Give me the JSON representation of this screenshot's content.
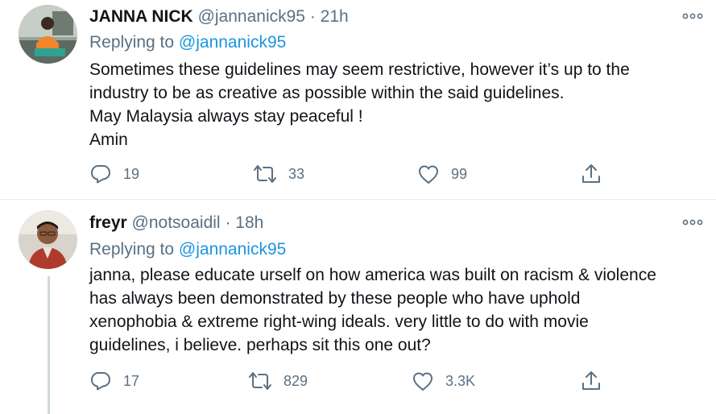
{
  "tweets": [
    {
      "display_name": "JANNA NICK",
      "handle": "@jannanick95",
      "separator": "·",
      "time": "21h",
      "replying_prefix": "Replying to",
      "replying_to": "@jannanick95",
      "body_lines": [
        "Sometimes these guidelines may seem restrictive, however it’s up to the",
        "industry to be as creative as possible within the said guidelines.",
        "May Malaysia always stay peaceful !",
        "Amin"
      ],
      "replies": "19",
      "retweets": "33",
      "likes": "99",
      "icons": {
        "avatar": "avatar-photo",
        "more": "more-options-icon",
        "reply": "reply-icon",
        "retweet": "retweet-icon",
        "like": "heart-icon",
        "share": "share-icon"
      }
    },
    {
      "display_name": "freyr",
      "handle": "@notsoaidil",
      "separator": "·",
      "time": "18h",
      "replying_prefix": "Replying to",
      "replying_to": "@jannanick95",
      "body_lines": [
        "janna, please educate urself on how america was built on racism & violence",
        "has always been demonstrated by these people who have uphold",
        "xenophobia & extreme right-wing ideals. very little to do with movie",
        "guidelines, i believe. perhaps sit this one out?"
      ],
      "replies": "17",
      "retweets": "829",
      "likes": "3.3K",
      "icons": {
        "avatar": "avatar-photo",
        "more": "more-options-icon",
        "reply": "reply-icon",
        "retweet": "retweet-icon",
        "like": "heart-icon",
        "share": "share-icon"
      }
    }
  ],
  "colors": {
    "text_primary": "#0f1419",
    "text_secondary": "#5b7083",
    "link": "#1b95e0",
    "divider": "#e6ecf0",
    "thread_line": "#cfd9de"
  }
}
